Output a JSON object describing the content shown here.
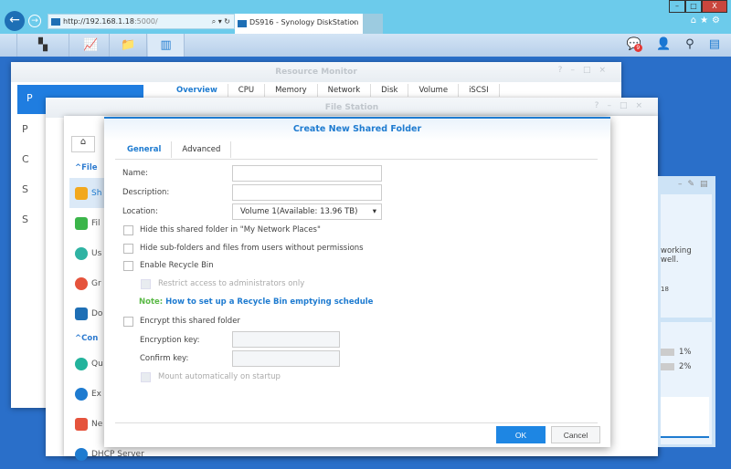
{
  "browser": {
    "url_host": "http://192.168.1.18",
    "url_port": ":5000/",
    "tab_title": "DS916 - Synology DiskStation",
    "win_min": "–",
    "win_max": "□",
    "win_close": "X",
    "nav_back": "←",
    "nav_forward": "→",
    "addr_controls": "⌕ ▾ ↻",
    "ie_tools": "⌂★⚙"
  },
  "taskbar": {
    "notification_count": "9"
  },
  "resource_monitor": {
    "title": "Resource Monitor",
    "tabs": [
      "Overview",
      "CPU",
      "Memory",
      "Network",
      "Disk",
      "Volume",
      "iSCSI"
    ],
    "sidebar": [
      "P",
      "P",
      "C",
      "S",
      "S"
    ]
  },
  "file_station": {
    "title": "File Station"
  },
  "control_panel": {
    "sections": [
      "File",
      "Con"
    ],
    "items": [
      "Sh",
      "Fil",
      "Us",
      "Gr",
      "Do",
      "Qu",
      "Ex",
      "Ne",
      "DHCP Server"
    ]
  },
  "dialog": {
    "title": "Create New Shared Folder",
    "tabs": [
      "General",
      "Advanced"
    ],
    "name_label": "Name:",
    "name_value": "",
    "description_label": "Description:",
    "description_value": "",
    "location_label": "Location:",
    "location_value": "Volume 1(Available: 13.96 TB)",
    "hide_network_places": "Hide this shared folder in \"My Network Places\"",
    "hide_subfolders": "Hide sub-folders and files from users without permissions",
    "enable_recycle": "Enable Recycle Bin",
    "restrict_admin": "Restrict access to administrators only",
    "note_label": "Note:",
    "note_link": "How to set up a Recycle Bin emptying schedule",
    "encrypt": "Encrypt this shared folder",
    "encryption_key_label": "Encryption key:",
    "confirm_key_label": "Confirm key:",
    "mount_auto": "Mount automatically on startup",
    "ok": "OK",
    "cancel": "Cancel"
  },
  "widget": {
    "status_text": "working well.",
    "time_frag": "18",
    "cpu": "1%",
    "ram": "2%"
  }
}
